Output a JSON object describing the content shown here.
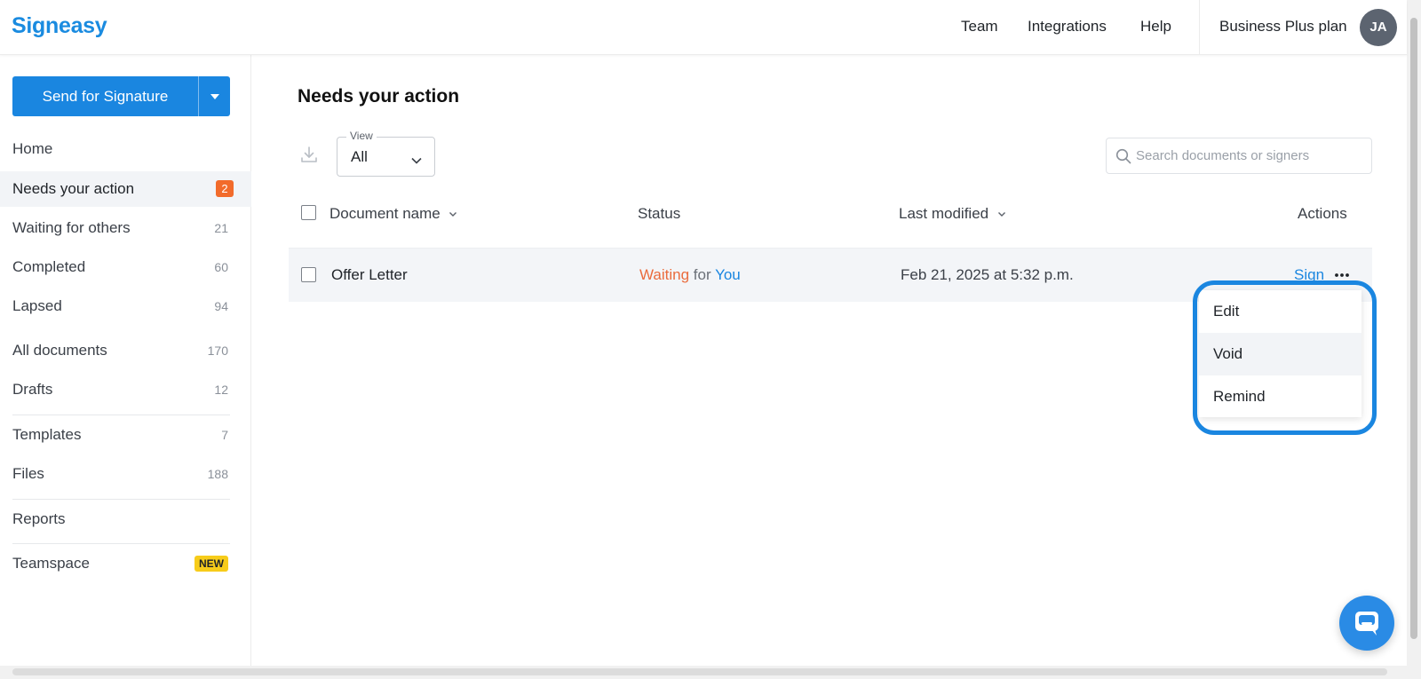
{
  "header": {
    "logo": "Signeasy",
    "nav": [
      "Team",
      "Integrations",
      "Help"
    ],
    "plan": "Business Plus plan",
    "avatar_initials": "JA"
  },
  "sidebar": {
    "send_button": "Send for Signature",
    "items": [
      {
        "label": "Home",
        "count": ""
      },
      {
        "label": "Needs your action",
        "count": "2",
        "active": true
      },
      {
        "label": "Waiting for others",
        "count": "21"
      },
      {
        "label": "Completed",
        "count": "60"
      },
      {
        "label": "Lapsed",
        "count": "94"
      },
      {
        "label": "All documents",
        "count": "170"
      },
      {
        "label": "Drafts",
        "count": "12"
      },
      {
        "label": "Templates",
        "count": "7"
      },
      {
        "label": "Files",
        "count": "188"
      },
      {
        "label": "Reports",
        "count": ""
      },
      {
        "label": "Teamspace",
        "badge": "NEW"
      }
    ]
  },
  "main": {
    "title": "Needs your action",
    "view": {
      "legend": "View",
      "value": "All"
    },
    "search": {
      "placeholder": "Search documents or signers"
    },
    "columns": [
      "Document name",
      "Status",
      "Last modified",
      "Actions"
    ],
    "rows": [
      {
        "name": "Offer Letter",
        "status_waiting": "Waiting",
        "status_for": "for",
        "status_you": "You",
        "modified": "Feb 21, 2025 at 5:32 p.m.",
        "action": "Sign"
      }
    ],
    "menu": [
      "Edit",
      "Void",
      "Remind"
    ]
  },
  "colors": {
    "accent": "#1a86e0",
    "badge_orange": "#f26b2b",
    "badge_new": "#f7cc1a",
    "status_waiting": "#ea6b3c"
  }
}
